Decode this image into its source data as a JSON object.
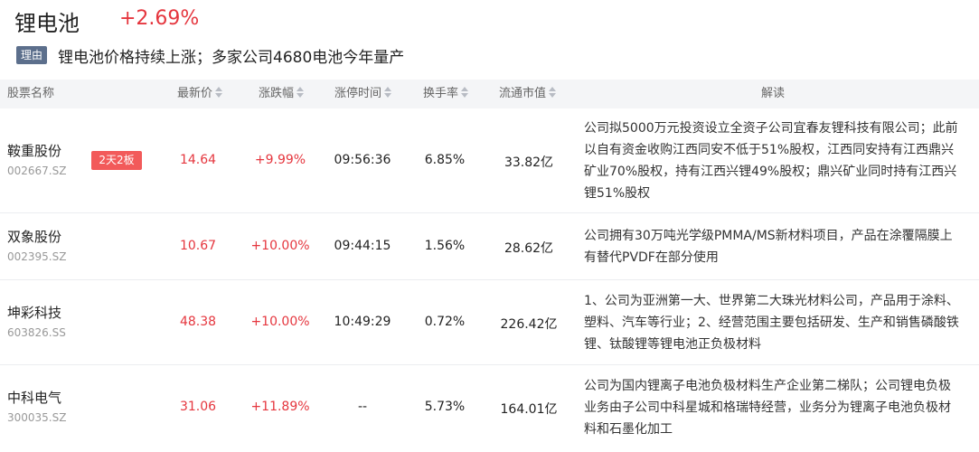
{
  "header": {
    "sector_name": "锂电池",
    "sector_change": "+2.69%",
    "reason_label": "理由",
    "reason_text": "锂电池价格持续上涨；多家公司4680电池今年量产"
  },
  "columns": {
    "name": "股票名称",
    "price": "最新价",
    "change": "涨跌幅",
    "limit_time": "涨停时间",
    "turnover": "换手率",
    "market_cap": "流通市值",
    "interpretation": "解读"
  },
  "rows": [
    {
      "name": "鞍重股份",
      "code": "002667.SZ",
      "badge": "2天2板",
      "price": "14.64",
      "change": "+9.99%",
      "limit_time": "09:56:36",
      "turnover": "6.85%",
      "market_cap": "33.82亿",
      "interpretation": "公司拟5000万元投资设立全资子公司宜春友锂科技有限公司；此前以自有资金收购江西同安不低于51%股权，江西同安持有江西鼎兴矿业70%股权，持有江西兴锂49%股权；鼎兴矿业同时持有江西兴锂51%股权"
    },
    {
      "name": "双象股份",
      "code": "002395.SZ",
      "badge": "",
      "price": "10.67",
      "change": "+10.00%",
      "limit_time": "09:44:15",
      "turnover": "1.56%",
      "market_cap": "28.62亿",
      "interpretation": "公司拥有30万吨光学级PMMA/MS新材料项目，产品在涂覆隔膜上有替代PVDF在部分使用"
    },
    {
      "name": "坤彩科技",
      "code": "603826.SS",
      "badge": "",
      "price": "48.38",
      "change": "+10.00%",
      "limit_time": "10:49:29",
      "turnover": "0.72%",
      "market_cap": "226.42亿",
      "interpretation": "1、公司为亚洲第一大、世界第二大珠光材料公司，产品用于涂料、塑料、汽车等行业；2、经营范围主要包括研发、生产和销售磷酸铁锂、钛酸锂等锂电池正负极材料"
    },
    {
      "name": "中科电气",
      "code": "300035.SZ",
      "badge": "",
      "price": "31.06",
      "change": "+11.89%",
      "limit_time": "--",
      "turnover": "5.73%",
      "market_cap": "164.01亿",
      "interpretation": "公司为国内锂离子电池负极材料生产企业第二梯队；公司锂电负极业务由子公司中科星城和格瑞特经营，业务分为锂离子电池负极材料和石墨化加工"
    }
  ]
}
